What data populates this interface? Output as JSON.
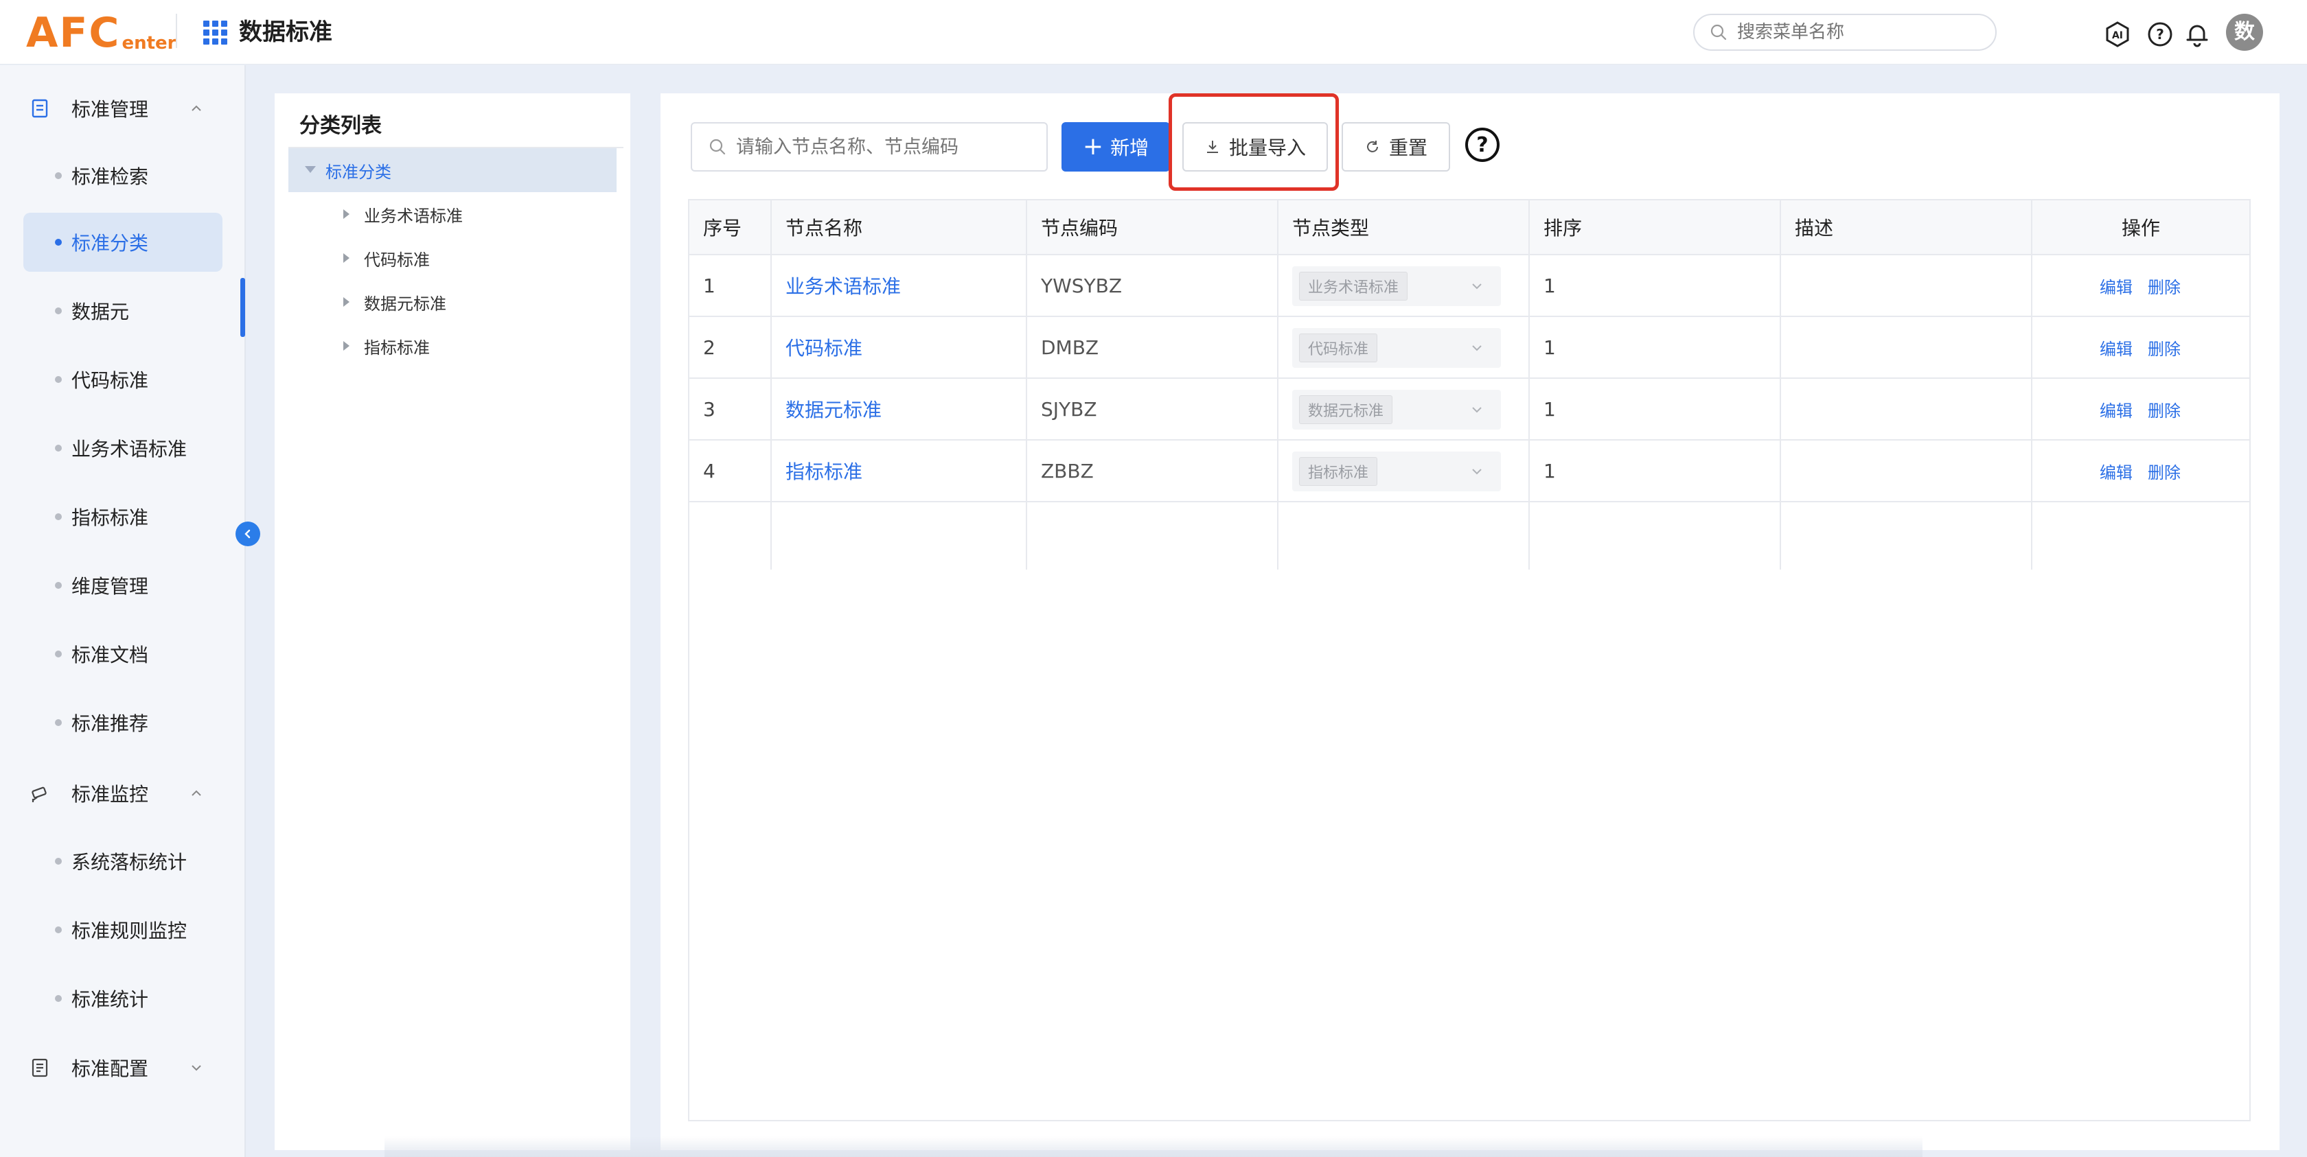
{
  "header": {
    "logo_main": "AFC",
    "logo_sub": "enter",
    "app_title": "数据标准",
    "search_placeholder": "搜索菜单名称",
    "avatar_text": "数"
  },
  "sidebar": {
    "groups": [
      {
        "label": "标准管理",
        "icon": "document-icon",
        "items": [
          "标准检索",
          "标准分类",
          "数据元",
          "代码标准",
          "业务术语标准",
          "指标标准",
          "维度管理",
          "标准文档",
          "标准推荐"
        ]
      },
      {
        "label": "标准监控",
        "icon": "monitor-camera-icon",
        "items": [
          "系统落标统计",
          "标准规则监控",
          "标准统计"
        ]
      },
      {
        "label": "标准配置",
        "icon": "list-document-icon",
        "items": []
      }
    ],
    "active_item": "标准分类"
  },
  "category_panel": {
    "title": "分类列表",
    "root": "标准分类",
    "children": [
      "业务术语标准",
      "代码标准",
      "数据元标准",
      "指标标准"
    ]
  },
  "toolbar": {
    "search_placeholder": "请输入节点名称、节点编码",
    "add_label": "新增",
    "import_label": "批量导入",
    "reset_label": "重置",
    "help_label": "?"
  },
  "table": {
    "columns": [
      "序号",
      "节点名称",
      "节点编码",
      "节点类型",
      "排序",
      "描述",
      "操作"
    ],
    "rows": [
      {
        "index": "1",
        "name": "业务术语标准",
        "code": "YWSYBZ",
        "type": "业务术语标准",
        "sort": "1",
        "desc": "",
        "edit": "编辑",
        "delete": "删除"
      },
      {
        "index": "2",
        "name": "代码标准",
        "code": "DMBZ",
        "type": "代码标准",
        "sort": "1",
        "desc": "",
        "edit": "编辑",
        "delete": "删除"
      },
      {
        "index": "3",
        "name": "数据元标准",
        "code": "SJYBZ",
        "type": "数据元标准",
        "sort": "1",
        "desc": "",
        "edit": "编辑",
        "delete": "删除"
      },
      {
        "index": "4",
        "name": "指标标准",
        "code": "ZBBZ",
        "type": "指标标准",
        "sort": "1",
        "desc": "",
        "edit": "编辑",
        "delete": "删除"
      }
    ]
  },
  "colors": {
    "primary": "#2b6fe6",
    "logo": "#f07b22",
    "highlight": "#e03328"
  }
}
